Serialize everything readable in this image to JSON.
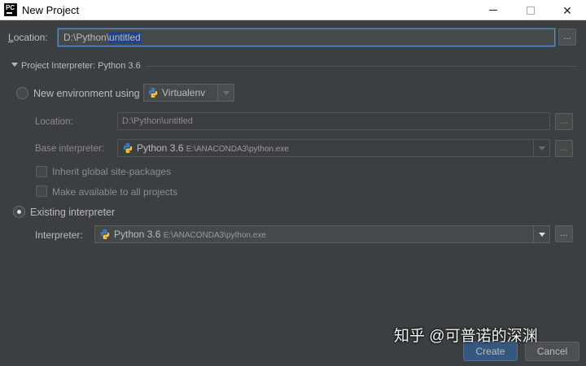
{
  "window": {
    "title": "New Project",
    "minimize_glyph": "—",
    "maximize_glyph": "☐",
    "close_glyph": "✕"
  },
  "location": {
    "label_mnemonic": "L",
    "label_rest": "ocation:",
    "value_prefix": "D:\\Python\\",
    "value_selected": "untitled",
    "browse_label": "..."
  },
  "interpreter_section": {
    "title": "Project Interpreter: Python 3.6"
  },
  "new_environment": {
    "label": "New environment using",
    "tool": "Virtualenv",
    "selected": false,
    "location_label": "Location:",
    "location_value": "D:\\Python\\untitled",
    "base_interpreter_label": "Base interpreter:",
    "base_interpreter_name": "Python 3.6",
    "base_interpreter_path": "E:\\ANACONDA3\\python.exe",
    "inherit_label": "Inherit global site-packages",
    "inherit_checked": false,
    "make_available_label": "Make available to all projects",
    "make_available_checked": false,
    "browse_label": "..."
  },
  "existing_interpreter": {
    "label": "Existing interpreter",
    "selected": true,
    "interpreter_label": "Interpreter:",
    "interpreter_name": "Python 3.6",
    "interpreter_path": "E:\\ANACONDA3\\python.exe",
    "browse_label": "..."
  },
  "buttons": {
    "create": "Create",
    "cancel": "Cancel"
  },
  "watermark": "知乎 @可普诺的深渊",
  "colors": {
    "dialog_bg": "#3c3f41",
    "field_bg": "#45494a",
    "focus_border": "#5a8ad0",
    "selection": "#214283",
    "primary_button": "#365880"
  },
  "icons": {
    "app": "pycharm-icon",
    "python": "python-logo-icon",
    "section_toggle": "triangle-down-icon",
    "dropdown": "chevron-down-icon"
  }
}
